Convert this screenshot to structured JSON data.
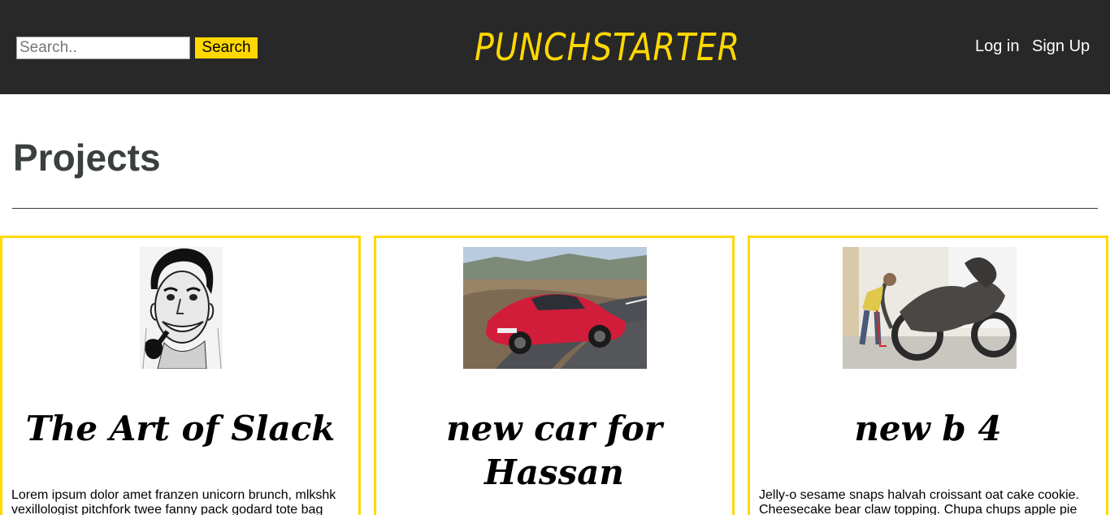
{
  "header": {
    "search_placeholder": "Search..",
    "search_button": "Search",
    "logo": "PUNCHSTARTER",
    "login": "Log in",
    "signup": "Sign Up"
  },
  "main": {
    "title": "Projects"
  },
  "projects": [
    {
      "image": "pipe-man-illustration",
      "title": "The Art of Slack",
      "description": "Lorem ipsum dolor amet franzen unicorn brunch, mlkshk vexillologist pitchfork twee fanny pack godard tote bag"
    },
    {
      "image": "red-sports-car-photo",
      "title": "new car for Hassan",
      "description": ""
    },
    {
      "image": "dragon-motorcycle-photo",
      "title": "new b 4",
      "description": "Jelly-o sesame snaps halvah croissant oat cake cookie. Cheesecake bear claw topping. Chupa chups apple pie"
    }
  ],
  "colors": {
    "accent": "#ffd800",
    "header_bg": "#282828",
    "title_text": "#3a3f3f"
  }
}
